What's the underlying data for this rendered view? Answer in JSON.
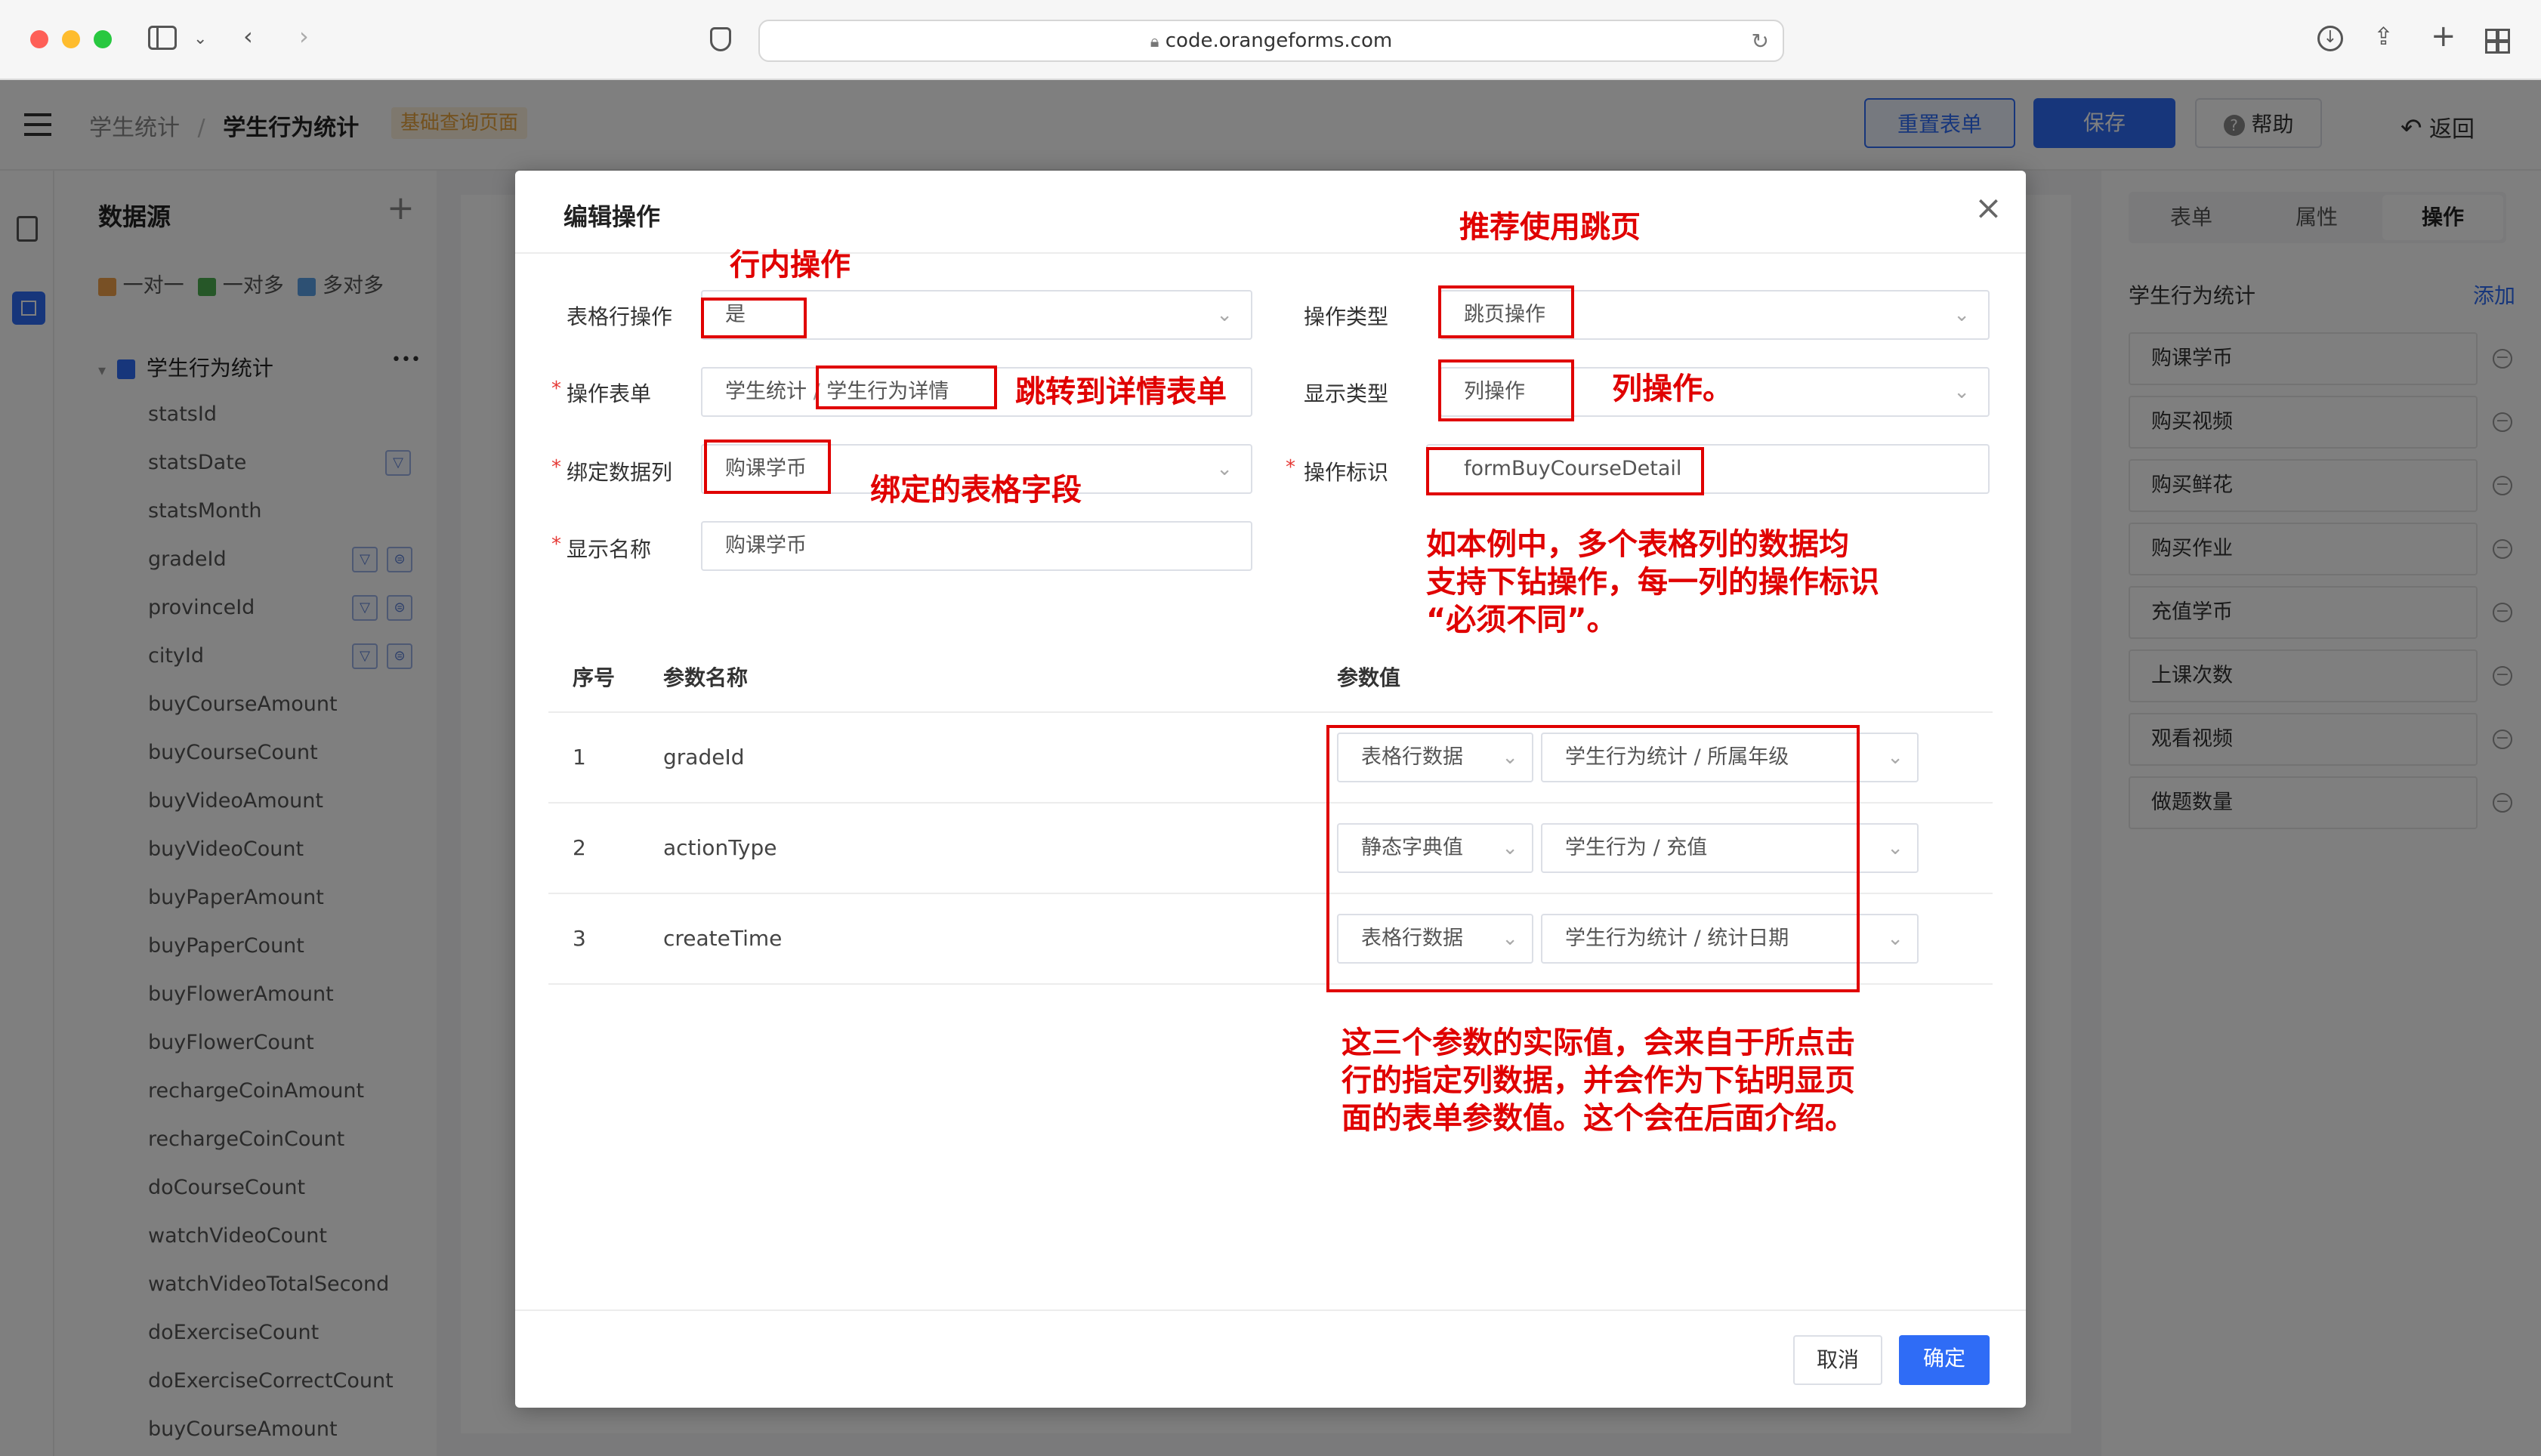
{
  "browser": {
    "url": "code.orangeforms.com"
  },
  "app_header": {
    "breadcrumb_root": "学生统计",
    "breadcrumb_sep": "/",
    "page_title": "学生行为统计",
    "page_tag": "基础查询页面",
    "reset_button": "重置表单",
    "save_button": "保存",
    "help_button": "帮助",
    "back_button": "返回"
  },
  "datasource_panel": {
    "title": "数据源",
    "add": "+",
    "relations": [
      "一对一",
      "一对多",
      "多对多"
    ],
    "root_node": "学生行为统计",
    "more": "•••",
    "fields": [
      "statsId",
      "statsDate",
      "statsMonth",
      "gradeId",
      "provinceId",
      "cityId",
      "buyCourseAmount",
      "buyCourseCount",
      "buyVideoAmount",
      "buyVideoCount",
      "buyPaperAmount",
      "buyPaperCount",
      "buyFlowerAmount",
      "buyFlowerCount",
      "rechargeCoinAmount",
      "rechargeCoinCount",
      "doCourseCount",
      "watchVideoCount",
      "watchVideoTotalSecond",
      "doExerciseCount",
      "doExerciseCorrectCount",
      "buyCourseAmount"
    ]
  },
  "right_panel": {
    "tabs": [
      "表单",
      "属性",
      "操作"
    ],
    "section_title": "学生行为统计",
    "add_link": "添加",
    "items": [
      "购课学币",
      "购买视频",
      "购买鲜花",
      "购买作业",
      "充值学币",
      "上课次数",
      "观看视频",
      "做题数量"
    ]
  },
  "dialog": {
    "title": "编辑操作",
    "close": "×",
    "form": {
      "row_op_label": "表格行操作",
      "row_op_value": "是",
      "op_type_label": "操作类型",
      "op_type_value": "跳页操作",
      "op_form_label": "操作表单",
      "op_form_value_1": "学生统计",
      "op_form_sep": "/",
      "op_form_value_2": "学生行为详情",
      "display_type_label": "显示类型",
      "display_type_value": "列操作",
      "bind_col_label": "绑定数据列",
      "bind_col_value": "购课学币",
      "op_id_label": "操作标识",
      "op_id_value": "formBuyCourseDetail",
      "display_name_label": "显示名称",
      "display_name_value": "购课学币",
      "required_mark": "*"
    },
    "table": {
      "headers": [
        "序号",
        "参数名称",
        "参数值"
      ],
      "rows": [
        {
          "no": "1",
          "name": "gradeId",
          "source": "表格行数据",
          "value": "学生行为统计 / 所属年级"
        },
        {
          "no": "2",
          "name": "actionType",
          "source": "静态字典值",
          "value": "学生行为 / 充值"
        },
        {
          "no": "3",
          "name": "createTime",
          "source": "表格行数据",
          "value": "学生行为统计 / 统计日期"
        }
      ]
    },
    "cancel_button": "取消",
    "confirm_button": "确定"
  },
  "annotations": {
    "row_inline": "行内操作",
    "recommend_jump": "推荐使用跳页",
    "jump_detail": "跳转到详情表单",
    "column_op": "列操作。",
    "bind_field": "绑定的表格字段",
    "op_id_note_1": "如本例中，多个表格列的数据均",
    "op_id_note_2": "支持下钻操作，每一列的操作标识",
    "op_id_note_3": "“必须不同”。",
    "param_note_1": "这三个参数的实际值，会来自于所点击",
    "param_note_2": "行的指定列数据，并会作为下钻明显页",
    "param_note_3": "面的表单参数值。这个会在后面介绍。"
  },
  "colors": {
    "primary": "#2f6cf6",
    "annotation_red": "#e00000",
    "danger": "#e53935"
  }
}
